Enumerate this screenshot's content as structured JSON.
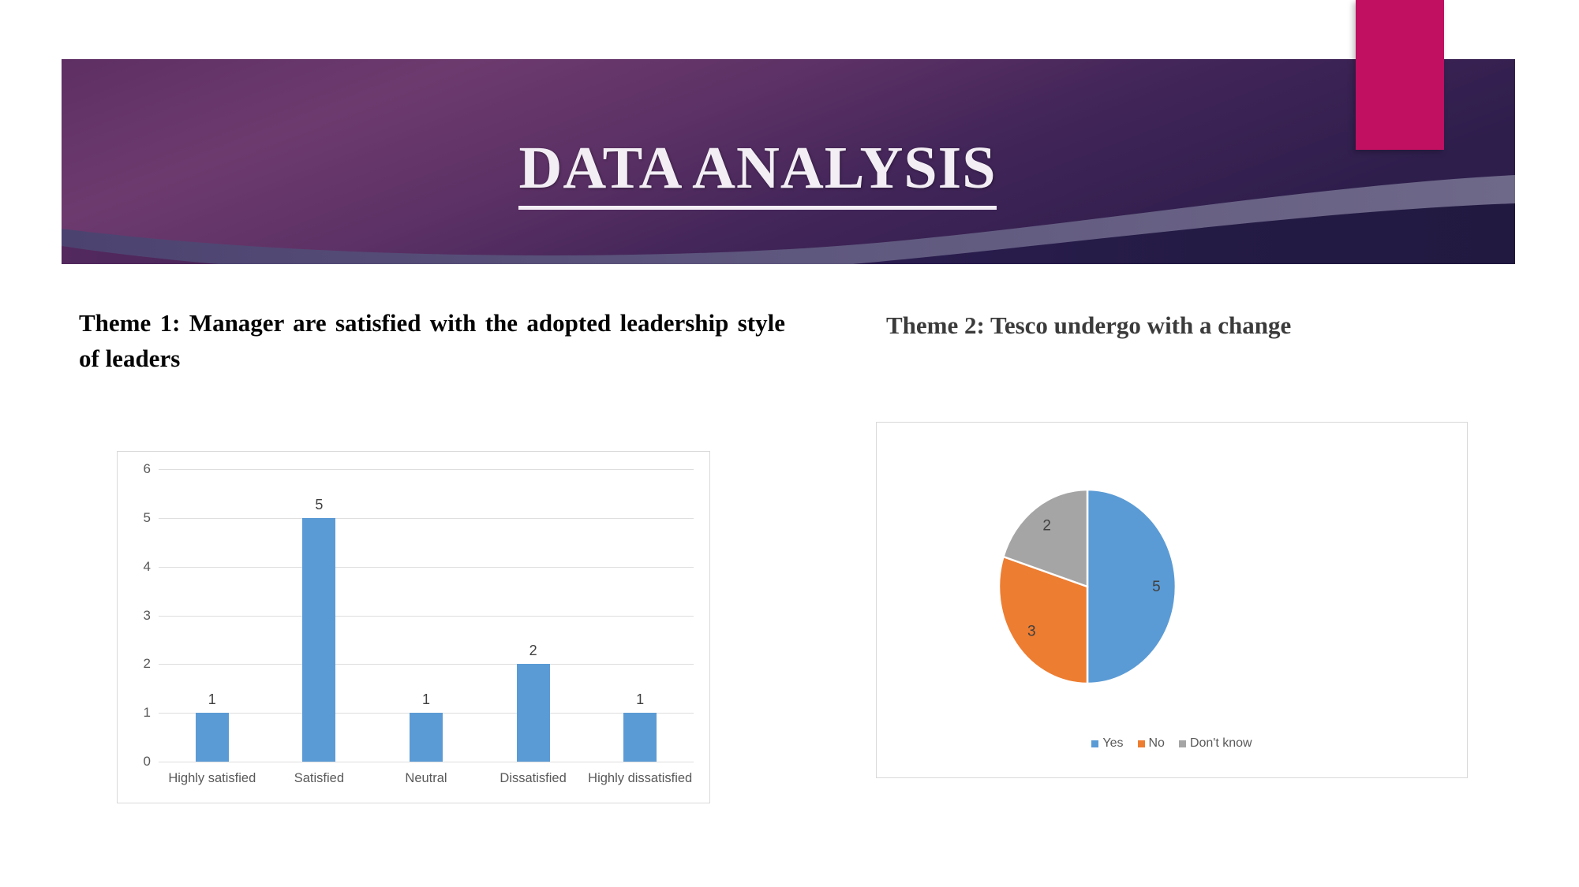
{
  "slide": {
    "title": "DATA ANALYSIS",
    "banner_colors": {
      "purple_dark": "#241C47",
      "purple_mid": "#4A2A5C",
      "purple_light": "#7A4877",
      "wave_band": "#5B5480",
      "pink_tab": "#C10F61"
    }
  },
  "themes": {
    "theme1": "Theme 1: Manager are satisfied with the adopted leadership style of leaders",
    "theme2": "Theme 2: Tesco undergo with a change"
  },
  "chart_data": [
    {
      "type": "bar",
      "title": "",
      "xlabel": "",
      "ylabel": "",
      "categories": [
        "Highly satisfied",
        "Satisfied",
        "Neutral",
        "Dissatisfied",
        "Highly dissatisfied"
      ],
      "values": [
        1,
        5,
        1,
        2,
        1
      ],
      "ylim": [
        0,
        6
      ],
      "yticks": [
        0,
        1,
        2,
        3,
        4,
        5,
        6
      ],
      "grid": true,
      "legend": "none",
      "series_color": "#5B9BD5"
    },
    {
      "type": "pie",
      "title": "",
      "labels": [
        "Yes",
        "No",
        "Don't know"
      ],
      "values": [
        5,
        3,
        2
      ],
      "colors": [
        "#5B9BD5",
        "#ED7D31",
        "#A5A5A5"
      ],
      "legend": "bottom",
      "data_labels": [
        "5",
        "3",
        "2"
      ]
    }
  ]
}
